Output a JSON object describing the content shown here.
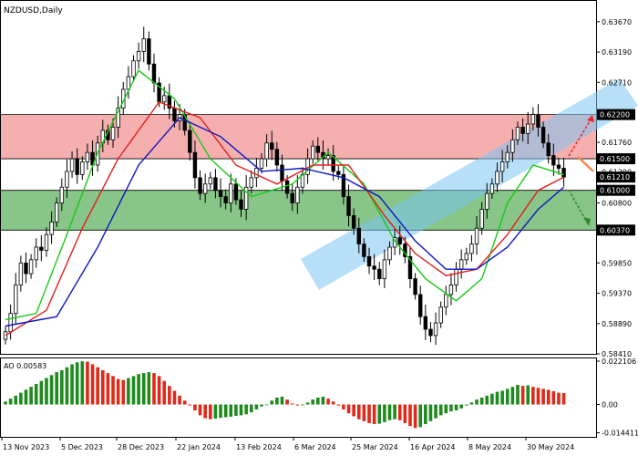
{
  "chart_data": {
    "type": "candlestick",
    "title": "NZDUSD,Daily",
    "indicator_title": "AO 0.00583",
    "price_axis": {
      "ylim": [
        0.5841,
        0.64
      ],
      "ticks": [
        "0.63670",
        "0.63190",
        "0.62710",
        "0.61760",
        "0.61290",
        "0.60800",
        "0.59850",
        "0.59370",
        "0.58890",
        "0.58410"
      ]
    },
    "ao_axis": {
      "ylim": [
        -0.0165,
        0.0235
      ],
      "ticks": [
        "0.022106",
        "0.00",
        "-0.014411"
      ]
    },
    "x_labels": [
      "13 Nov 2023",
      "5 Dec 2023",
      "28 Dec 2023",
      "22 Jan 2024",
      "13 Feb 2024",
      "6 Mar 2024",
      "25 Mar 2024",
      "16 Apr 2024",
      "8 May 2024",
      "30 May 2024"
    ],
    "levels": [
      {
        "label": "0.62200",
        "value": 0.622
      },
      {
        "label": "0.61500",
        "value": 0.615
      },
      {
        "label": "0.61210",
        "value": 0.6121
      },
      {
        "label": "0.61000",
        "value": 0.61
      },
      {
        "label": "0.60370",
        "value": 0.6037
      }
    ],
    "zones": [
      {
        "name": "resistance",
        "from": 0.615,
        "to": 0.622,
        "color": "#f4a6a6"
      },
      {
        "name": "support",
        "from": 0.6037,
        "to": 0.61,
        "color": "#7bbf7b"
      }
    ],
    "close": [
      0.5876,
      0.5905,
      0.595,
      0.5985,
      0.5968,
      0.599,
      0.601,
      0.6005,
      0.603,
      0.605,
      0.608,
      0.6105,
      0.613,
      0.615,
      0.6125,
      0.6145,
      0.616,
      0.614,
      0.6175,
      0.6195,
      0.618,
      0.62,
      0.623,
      0.626,
      0.628,
      0.6305,
      0.632,
      0.634,
      0.63,
      0.627,
      0.624,
      0.625,
      0.623,
      0.621,
      0.622,
      0.6195,
      0.616,
      0.612,
      0.6095,
      0.611,
      0.612,
      0.61,
      0.609,
      0.608,
      0.611,
      0.6085,
      0.607,
      0.6105,
      0.612,
      0.6135,
      0.615,
      0.6175,
      0.6165,
      0.614,
      0.6115,
      0.6095,
      0.608,
      0.6105,
      0.6125,
      0.615,
      0.617,
      0.616,
      0.615,
      0.6155,
      0.613,
      0.6125,
      0.609,
      0.606,
      0.604,
      0.6015,
      0.5995,
      0.598,
      0.5975,
      0.596,
      0.599,
      0.601,
      0.6025,
      0.6015,
      0.5995,
      0.596,
      0.5935,
      0.59,
      0.588,
      0.587,
      0.589,
      0.5915,
      0.5935,
      0.595,
      0.5975,
      0.599,
      0.6,
      0.6015,
      0.604,
      0.607,
      0.6095,
      0.611,
      0.613,
      0.6145,
      0.616,
      0.618,
      0.62,
      0.619,
      0.6205,
      0.622,
      0.62,
      0.6175,
      0.6155,
      0.614,
      0.6135,
      0.6121
    ],
    "smma": [
      {
        "name": "SMMA fast",
        "color": "#17c917",
        "points": [
          [
            0,
            0.5895
          ],
          [
            6,
            0.5905
          ],
          [
            12,
            0.603
          ],
          [
            18,
            0.616
          ],
          [
            26,
            0.629
          ],
          [
            33,
            0.6245
          ],
          [
            40,
            0.615
          ],
          [
            48,
            0.609
          ],
          [
            56,
            0.611
          ],
          [
            63,
            0.616
          ],
          [
            70,
            0.611
          ],
          [
            76,
            0.602
          ],
          [
            82,
            0.596
          ],
          [
            88,
            0.5925
          ],
          [
            93,
            0.596
          ],
          [
            98,
            0.608
          ],
          [
            103,
            0.614
          ],
          [
            109,
            0.6125
          ]
        ]
      },
      {
        "name": "SMMA mid",
        "color": "#e0201c",
        "points": [
          [
            0,
            0.587
          ],
          [
            8,
            0.591
          ],
          [
            15,
            0.604
          ],
          [
            22,
            0.615
          ],
          [
            30,
            0.624
          ],
          [
            38,
            0.6215
          ],
          [
            45,
            0.614
          ],
          [
            53,
            0.611
          ],
          [
            60,
            0.614
          ],
          [
            67,
            0.614
          ],
          [
            74,
            0.606
          ],
          [
            80,
            0.6
          ],
          [
            86,
            0.5965
          ],
          [
            92,
            0.5975
          ],
          [
            98,
            0.603
          ],
          [
            104,
            0.61
          ],
          [
            109,
            0.6121
          ]
        ]
      },
      {
        "name": "SMMA slow",
        "color": "#1018c0",
        "points": [
          [
            0,
            0.5885
          ],
          [
            10,
            0.59
          ],
          [
            18,
            0.601
          ],
          [
            26,
            0.614
          ],
          [
            34,
            0.6215
          ],
          [
            42,
            0.6185
          ],
          [
            50,
            0.613
          ],
          [
            58,
            0.6135
          ],
          [
            66,
            0.612
          ],
          [
            73,
            0.609
          ],
          [
            80,
            0.602
          ],
          [
            86,
            0.5975
          ],
          [
            92,
            0.5975
          ],
          [
            98,
            0.601
          ],
          [
            104,
            0.607
          ],
          [
            109,
            0.6105
          ]
        ]
      }
    ],
    "ao": [
      0.0015,
      0.003,
      0.0045,
      0.006,
      0.0075,
      0.009,
      0.0105,
      0.012,
      0.0135,
      0.015,
      0.0165,
      0.0175,
      0.019,
      0.0205,
      0.0215,
      0.022,
      0.0218,
      0.0205,
      0.019,
      0.0175,
      0.016,
      0.0145,
      0.013,
      0.0125,
      0.0135,
      0.0145,
      0.0155,
      0.016,
      0.0165,
      0.016,
      0.0145,
      0.012,
      0.0095,
      0.007,
      0.0045,
      0.002,
      -0.0005,
      -0.003,
      -0.0055,
      -0.007,
      -0.0075,
      -0.0072,
      -0.0068,
      -0.0065,
      -0.0062,
      -0.0058,
      -0.0055,
      -0.005,
      -0.004,
      -0.0025,
      -0.001,
      0.0,
      0.002,
      0.0035,
      0.004,
      0.0025,
      0.0005,
      -0.0005,
      0.0,
      0.001,
      0.0025,
      0.0035,
      0.004,
      0.003,
      0.0015,
      -0.0005,
      -0.0025,
      -0.0045,
      -0.006,
      -0.0075,
      -0.0085,
      -0.0095,
      -0.01,
      -0.0098,
      -0.009,
      -0.008,
      -0.0075,
      -0.008,
      -0.0095,
      -0.011,
      -0.012,
      -0.0115,
      -0.01,
      -0.0085,
      -0.007,
      -0.0055,
      -0.0045,
      -0.0035,
      -0.003,
      -0.002,
      -0.0005,
      0.001,
      0.0025,
      0.0035,
      0.0045,
      0.0055,
      0.0065,
      0.007,
      0.008,
      0.009,
      0.01,
      0.0095,
      0.0098,
      0.009,
      0.0085,
      0.008,
      0.0075,
      0.0068,
      0.006,
      0.0058
    ]
  }
}
